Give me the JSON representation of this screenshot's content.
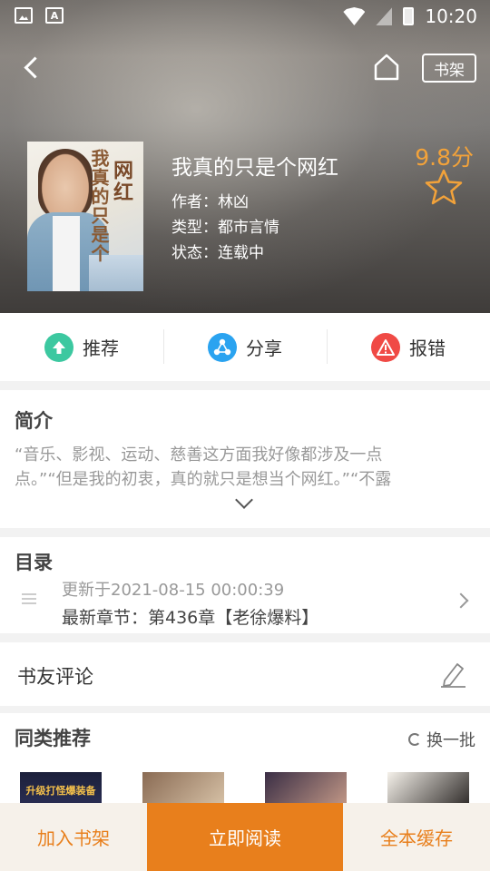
{
  "status_bar": {
    "time": "10:20"
  },
  "header": {
    "shelf_label": "书架"
  },
  "book": {
    "title": "我真的只是个网红",
    "author": "作者：林凶",
    "genre": "类型：都市言情",
    "status": "状态：连载中",
    "score": "9.8分",
    "cover_title_main": "网红",
    "cover_title_sub": "我真的只是个"
  },
  "actions": [
    {
      "label": "推荐",
      "icon": "up-arrow-icon",
      "color": "#3cc8a0"
    },
    {
      "label": "分享",
      "icon": "share-icon",
      "color": "#2aa3f0"
    },
    {
      "label": "报错",
      "icon": "warning-icon",
      "color": "#f04a45"
    }
  ],
  "intro": {
    "title": "简介",
    "text": "“音乐、影视、运动、慈善这方面我好像都涉及一点\n点。”“但是我的初衷，真的就只是想当个网红。”“不露"
  },
  "toc": {
    "title": "目录",
    "updated": "更新于2021-08-15 00:00:39",
    "latest": "最新章节：第436章【老徐爆料】"
  },
  "comments": {
    "title": "书友评论"
  },
  "similar": {
    "title": "同类推荐",
    "refresh_label": "换一批",
    "thumb1_text": "升级打怪爆装备"
  },
  "bottom_bar": {
    "add_shelf": "加入书架",
    "read_now": "立即阅读",
    "cache_all": "全本缓存"
  },
  "colors": {
    "accent": "#e87f1c",
    "score": "#f2a23a"
  }
}
